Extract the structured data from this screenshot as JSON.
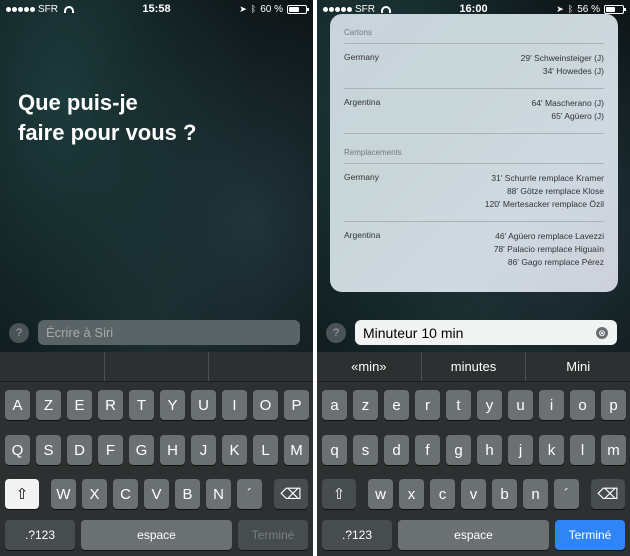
{
  "screen1": {
    "status": {
      "carrier": "SFR",
      "time": "15:58",
      "battery": "60 %",
      "battery_level": 0.6
    },
    "prompt_line1": "Que puis-je",
    "prompt_line2": "faire pour vous ?",
    "help": "?",
    "input": {
      "value": "",
      "placeholder": "Écrire à Siri"
    },
    "keyboard": {
      "row1": [
        "A",
        "Z",
        "E",
        "R",
        "T",
        "Y",
        "U",
        "I",
        "O",
        "P"
      ],
      "row2": [
        "Q",
        "S",
        "D",
        "F",
        "G",
        "H",
        "J",
        "K",
        "L",
        "M"
      ],
      "row3": [
        "W",
        "X",
        "C",
        "V",
        "B",
        "N",
        "´"
      ],
      "numbers": ".?123",
      "space": "espace",
      "done": "Terminé",
      "shift": "⇧",
      "delete": "⌫"
    }
  },
  "screen2": {
    "status": {
      "carrier": "SFR",
      "time": "16:00",
      "battery": "56 %",
      "battery_level": 0.56
    },
    "card": {
      "cards_title": "Cartons",
      "cards": [
        {
          "team": "Germany",
          "events": [
            "29' Schweinsteiger (J)",
            "34' Howedes (J)"
          ]
        },
        {
          "team": "Argentina",
          "events": [
            "64' Mascherano (J)",
            "65' Agüero (J)"
          ]
        }
      ],
      "subs_title": "Remplacements",
      "subs": [
        {
          "team": "Germany",
          "events": [
            "31' Schurrle remplace Kramer",
            "88' Götze remplace Klose",
            "120' Mertesacker remplace Özil"
          ]
        },
        {
          "team": "Argentina",
          "events": [
            "46' Agüero remplace Lavezzi",
            "78' Palacio remplace Higuaín",
            "86' Gago remplace Pérez"
          ]
        }
      ]
    },
    "help": "?",
    "input": {
      "value": "Minuteur 10 min",
      "placeholder": ""
    },
    "clear_icon": "⊗",
    "predictions": [
      "«min»",
      "minutes",
      "Mini"
    ],
    "keyboard": {
      "row1": [
        "a",
        "z",
        "e",
        "r",
        "t",
        "y",
        "u",
        "i",
        "o",
        "p"
      ],
      "row2": [
        "q",
        "s",
        "d",
        "f",
        "g",
        "h",
        "j",
        "k",
        "l",
        "m"
      ],
      "row3": [
        "w",
        "x",
        "c",
        "v",
        "b",
        "n",
        "´"
      ],
      "numbers": ".?123",
      "space": "espace",
      "done": "Terminé",
      "shift": "⇧",
      "delete": "⌫"
    }
  }
}
